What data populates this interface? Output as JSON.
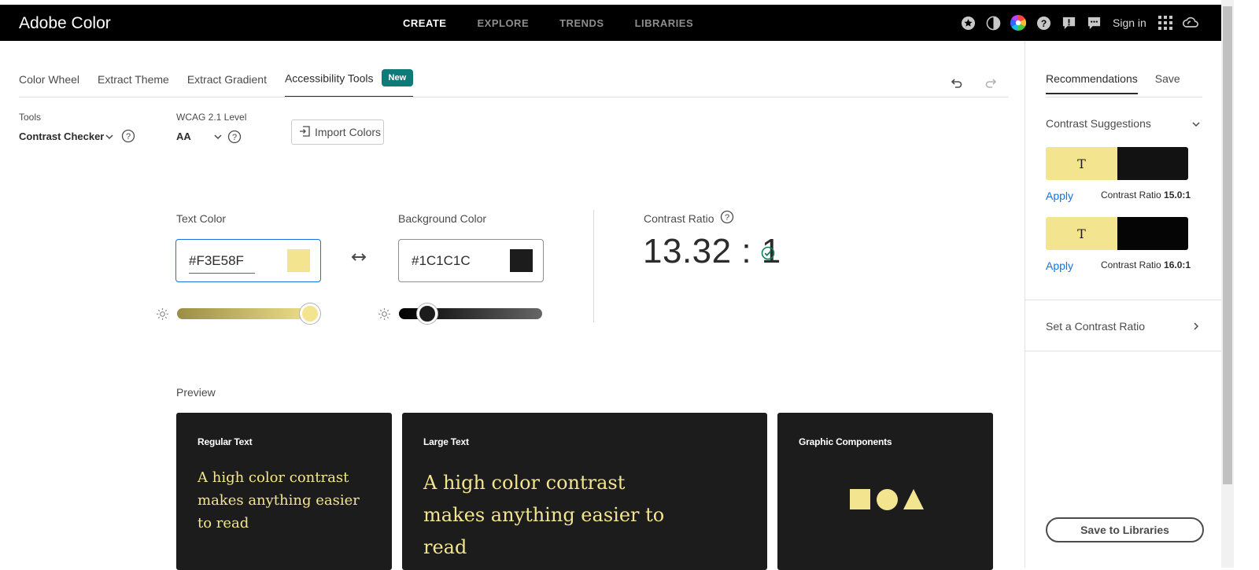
{
  "app": {
    "title": "Adobe Color"
  },
  "nav": {
    "items": [
      "CREATE",
      "EXPLORE",
      "TRENDS",
      "LIBRARIES"
    ],
    "active": "CREATE"
  },
  "topbar": {
    "sign_in": "Sign in",
    "icons": [
      "star-icon",
      "moon-icon",
      "color-wheel-icon",
      "help-icon",
      "alert-icon",
      "chat-icon",
      "apps-grid-icon",
      "creative-cloud-icon"
    ]
  },
  "tabs": [
    {
      "label": "Color Wheel"
    },
    {
      "label": "Extract Theme"
    },
    {
      "label": "Extract Gradient"
    },
    {
      "label": "Accessibility Tools",
      "badge": "New",
      "active": true
    }
  ],
  "toolbar": {
    "tools_label": "Tools",
    "tools_value": "Contrast Checker",
    "wcag_label": "WCAG 2.1 Level",
    "wcag_value": "AA",
    "import_label": "Import Colors"
  },
  "text_color": {
    "label": "Text Color",
    "hex": "#F3E58F",
    "swatch": "#f3e58f",
    "brightness": 0.93
  },
  "background_color": {
    "label": "Background Color",
    "hex": "#1C1C1C",
    "swatch": "#1c1c1c",
    "brightness": 0.2
  },
  "contrast": {
    "label": "Contrast Ratio",
    "value": "13.32 : 1",
    "status_color": "#12805c"
  },
  "preview": {
    "label": "Preview",
    "regular": {
      "title": "Regular Text",
      "text": "A high color contrast makes anything easier to read"
    },
    "large": {
      "title": "Large Text",
      "text": "A high color contrast makes anything easier to read"
    },
    "graphic": {
      "title": "Graphic Components"
    }
  },
  "right_panel": {
    "tabs": [
      "Recommendations",
      "Save"
    ],
    "suggestions_title": "Contrast Suggestions",
    "suggestions": [
      {
        "sample": "T",
        "text_color": "#f3e58f",
        "bg_color": "#121212",
        "apply": "Apply",
        "ratio_label": "Contrast Ratio",
        "ratio": "15.0:1"
      },
      {
        "sample": "T",
        "text_color": "#f3e58f",
        "bg_color": "#050505",
        "apply": "Apply",
        "ratio_label": "Contrast Ratio",
        "ratio": "16.0:1"
      }
    ],
    "set_ratio": "Set a Contrast Ratio",
    "save_to_libraries": "Save to Libraries"
  }
}
